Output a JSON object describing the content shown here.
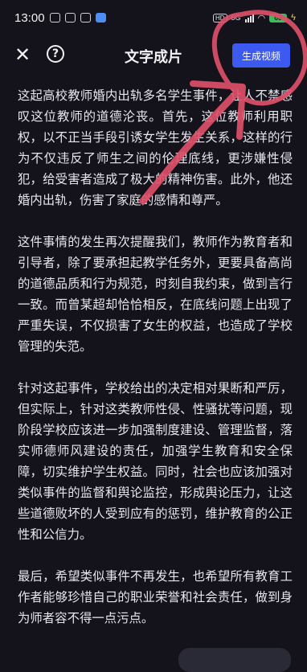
{
  "status_bar": {
    "time": "13:00",
    "hd": "HD",
    "network": "5G",
    "battery": "63"
  },
  "nav": {
    "close_icon": "close-icon",
    "help_icon": "question-circle-icon",
    "title": "文字成片",
    "generate_label": "生成视频"
  },
  "colors": {
    "background": "#14131c",
    "accent": "#3c5af0",
    "annotation": "#e0506a"
  },
  "article": {
    "paragraphs": [
      "这起高校教师婚内出轨多名学生事件，让人不禁感叹这位教师的道德沦丧。首先，这位教师利用职权，以不正当手段引诱女学生发生关系，这样的行为不仅违反了师生之间的伦理底线，更涉嫌性侵犯，给受害者造成了极大的精神伤害。此外，他还婚内出轨，伤害了家庭的感情和尊严。",
      "这件事情的发生再次提醒我们，教师作为教育者和引导者，除了要承担起教学任务外，更要具备高尚的道德品质和行为规范，时刻自我约束，做到言行一致。而曾某超却恰恰相反，在底线问题上出现了严重失误，不仅损害了女生的权益，也造成了学校管理的失范。",
      "针对这起事件，学校给出的决定相对果断和严厉，但实际上，针对这类教师性侵、性骚扰等问题，现阶段学校应该进一步加强制度建设、管理监督，落实师德师风建设的责任，加强学生教育和安全保障，切实维护学生权益。同时，社会也应该加强对类似事件的监督和舆论监控，形成舆论压力，让这些道德败坏的人受到应有的惩罚，维护教育的公正性和公信力。",
      "最后，希望类似事件不再发生，也希望所有教育工作者能够珍惜自己的职业荣誉和社会责任，做到身为师者容不得一点污点。"
    ]
  }
}
